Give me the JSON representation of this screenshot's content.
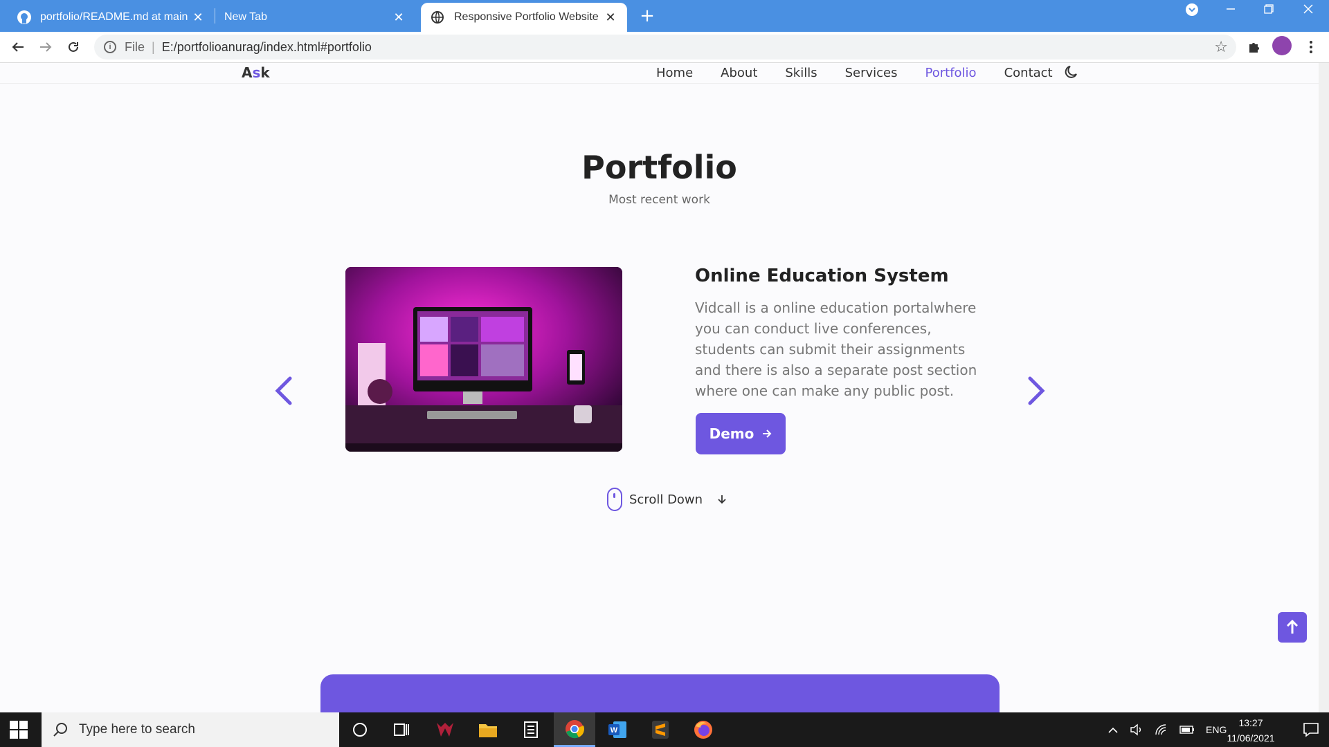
{
  "browser": {
    "tabs": [
      {
        "title": "portfolio/README.md at main · /",
        "close": "✕"
      },
      {
        "title": "New Tab",
        "close": "✕"
      },
      {
        "title": "Responsive Portfolio Website",
        "close": "✕"
      }
    ],
    "new_tab": "+",
    "address": {
      "scheme": "File",
      "url": "E:/portfolioanurag/index.html#portfolio"
    }
  },
  "site": {
    "logo": {
      "prefix": "A",
      "accent": "s",
      "suffix": "k"
    },
    "nav": [
      "Home",
      "About",
      "Skills",
      "Services",
      "Portfolio",
      "Contact"
    ],
    "active_nav": "Portfolio",
    "section": {
      "title": "Portfolio",
      "subtitle": "Most recent work"
    },
    "project": {
      "title": "Online Education System",
      "description": "Vidcall is a online education portalwhere you can conduct live conferences, students can submit their assignments and there is also a separate post section where one can make any public post.",
      "button": "Demo"
    },
    "scroll_label": "Scroll Down",
    "accent_color": "#6e57e0"
  },
  "taskbar": {
    "search_placeholder": "Type here to search",
    "language": "ENG",
    "time": "13:27",
    "date": "11/06/2021"
  }
}
